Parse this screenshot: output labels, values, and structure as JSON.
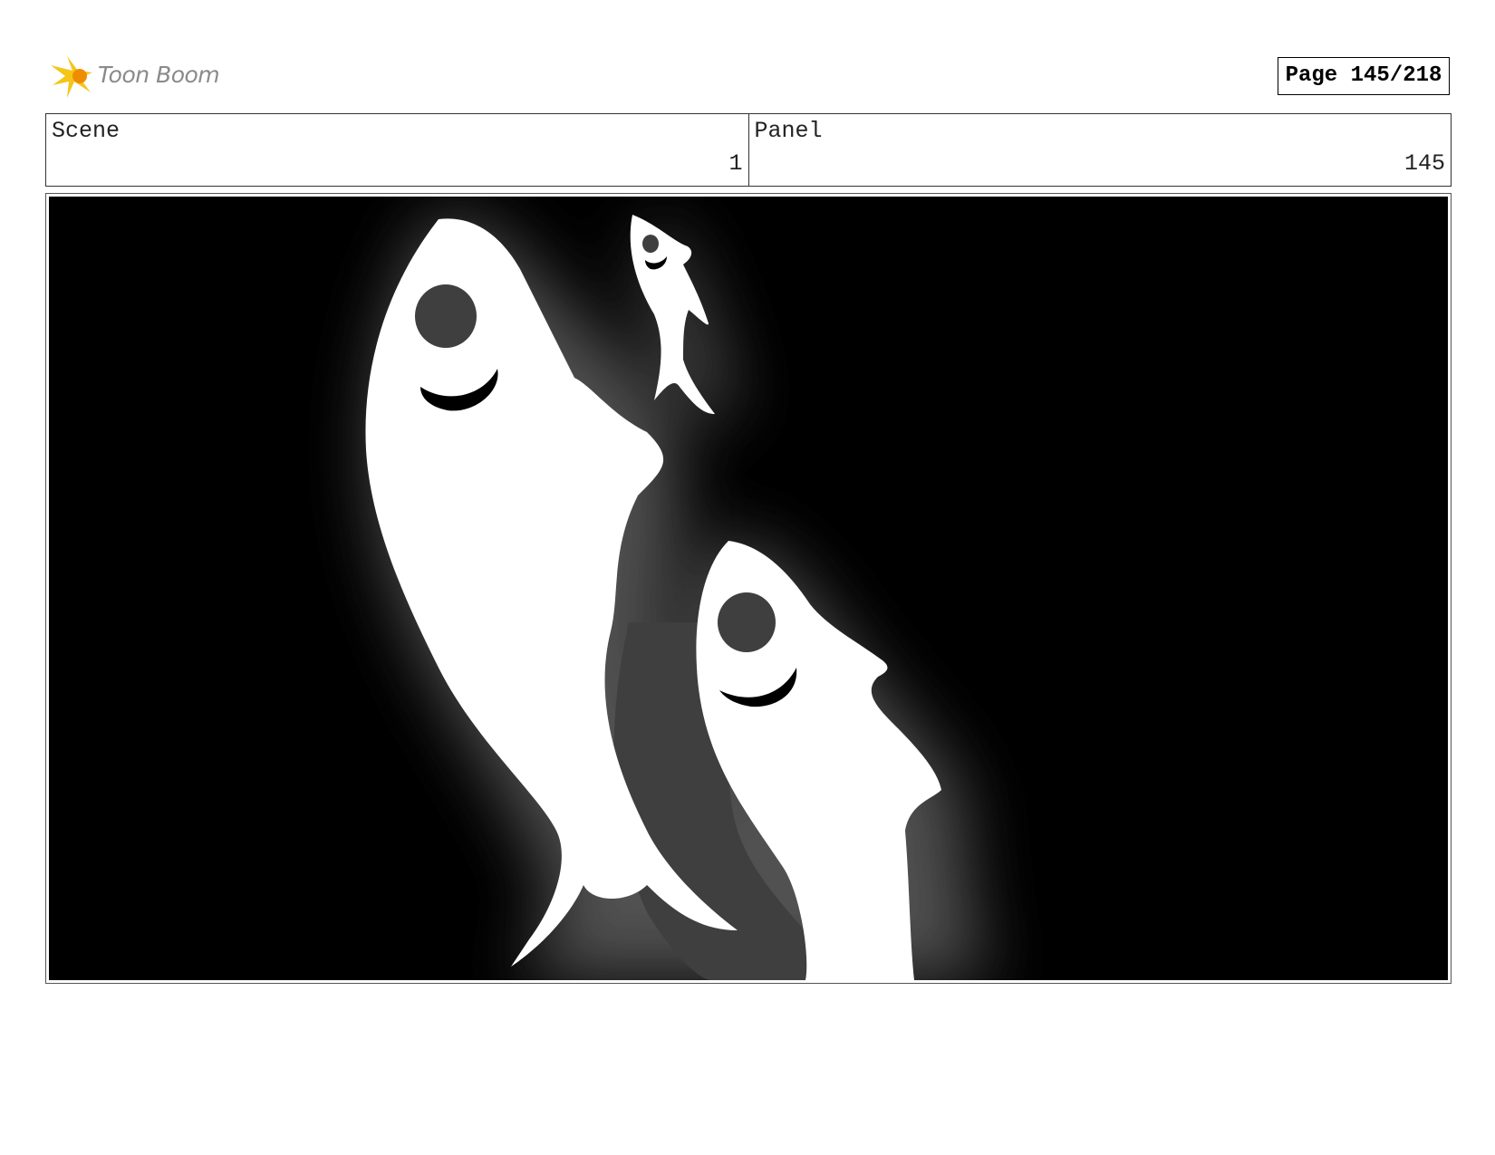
{
  "header": {
    "logo_text": "Toon Boom",
    "page_label": "Page 145/218"
  },
  "info": {
    "scene_label": "Scene",
    "scene_value": "1",
    "panel_label": "Panel",
    "panel_value": "145"
  },
  "panel_image": {
    "icon": "fish-silhouettes-illustration",
    "colors": {
      "background": "#000000",
      "fish": "#ffffff",
      "glow": "#4a4a4a"
    }
  }
}
